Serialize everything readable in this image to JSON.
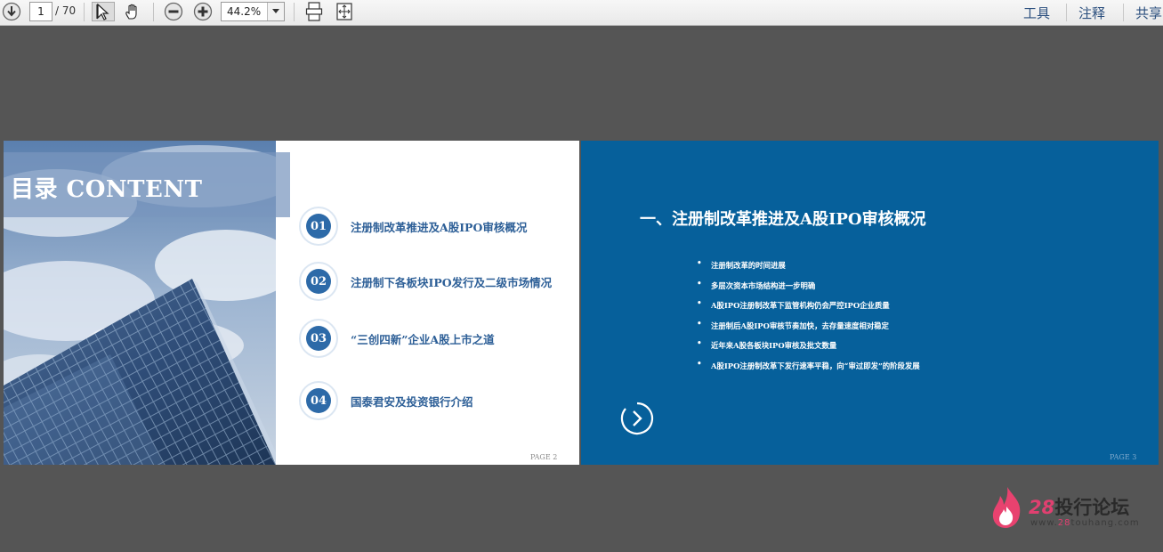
{
  "toolbar": {
    "current_page": "1",
    "page_total": "/ 70",
    "zoom": "44.2%",
    "menus": [
      "工具",
      "注释",
      "共享"
    ]
  },
  "icons": {
    "download": "download-arrow-icon",
    "select": "select-cursor-icon",
    "hand": "hand-icon",
    "zoom_out": "zoom-out-icon",
    "zoom_in": "zoom-in-icon",
    "dropdown": "chevron-down-icon",
    "fit_width": "fit-width-icon",
    "fit_page": "fit-page-icon"
  },
  "slide2": {
    "title": "目录 CONTENT",
    "items": [
      {
        "num": "01",
        "text": "注册制改革推进及A股IPO审核概况"
      },
      {
        "num": "02",
        "text": "注册制下各板块IPO发行及二级市场情况"
      },
      {
        "num": "03",
        "text": "“三创四新”企业A股上市之道"
      },
      {
        "num": "04",
        "text": "国泰君安及投资银行介绍"
      }
    ],
    "page_label": "PAGE 2"
  },
  "slide3": {
    "title": "一、注册制改革推进及A股IPO审核概况",
    "bullets": [
      "注册制改革的时间进展",
      "多层次资本市场结构进一步明确",
      "A股IPO注册制改革下监管机构仍会严控IPO企业质量",
      "注册制后A股IPO审核节奏加快，去存量速度相对稳定",
      "近年来A股各板块IPO审核及批文数量",
      "A股IPO注册制改革下发行速率平稳，向“审过即发”的阶段发展"
    ],
    "page_label": "PAGE 3"
  },
  "watermark": {
    "num": "28",
    "text": "投行论坛",
    "url_prefix": "www.",
    "url_num": "28",
    "url_suffix": "touhang.com"
  },
  "colors": {
    "viewer_bg": "#555555",
    "slide3_bg": "#06609b",
    "accent_blue": "#2d6aa8",
    "brand_pink": "#e04070"
  }
}
